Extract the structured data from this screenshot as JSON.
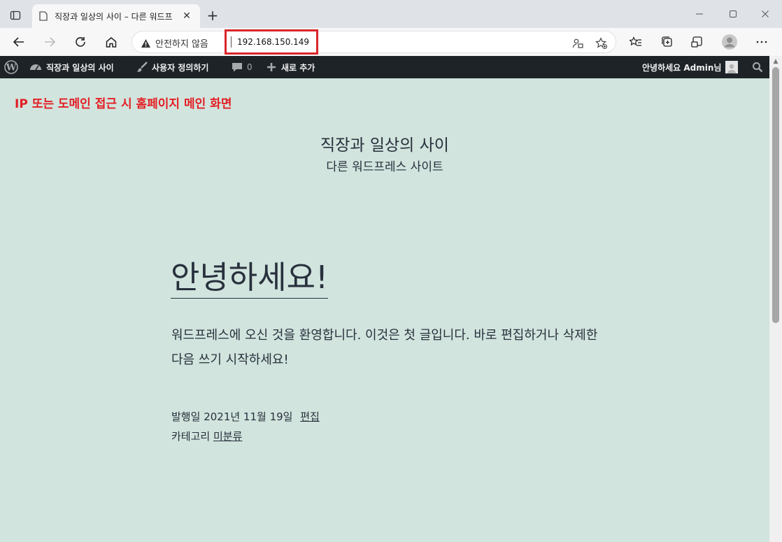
{
  "browser": {
    "tab_title": "직장과 일상의 사이 – 다른 워드프",
    "security_label": "안전하지 않음",
    "url": "192.168.150.149"
  },
  "admin_bar": {
    "site_name": "직장과 일상의 사이",
    "customize": "사용자 정의하기",
    "comments_count": "0",
    "new": "새로 추가",
    "greeting": "안녕하세요 Admin님"
  },
  "annotation": "IP 또는 도메인 접근 시 홈페이지 메인 화면",
  "site": {
    "title": "직장과 일상의 사이",
    "description": "다른 워드프레스 사이트"
  },
  "post": {
    "title": "안녕하세요!",
    "body": "워드프레스에 오신 것을 환영합니다. 이것은 첫 글입니다. 바로 편집하거나 삭제한 다음 쓰기 시작하세요!",
    "published_label": "발행일",
    "date": "2021년 11월 19일",
    "edit": "편집",
    "category_label": "카테고리",
    "category": "미분류"
  },
  "colors": {
    "content_bg": "#d1e4dd",
    "admin_bar_bg": "#1d2327",
    "annotation_red": "#e31e24"
  }
}
